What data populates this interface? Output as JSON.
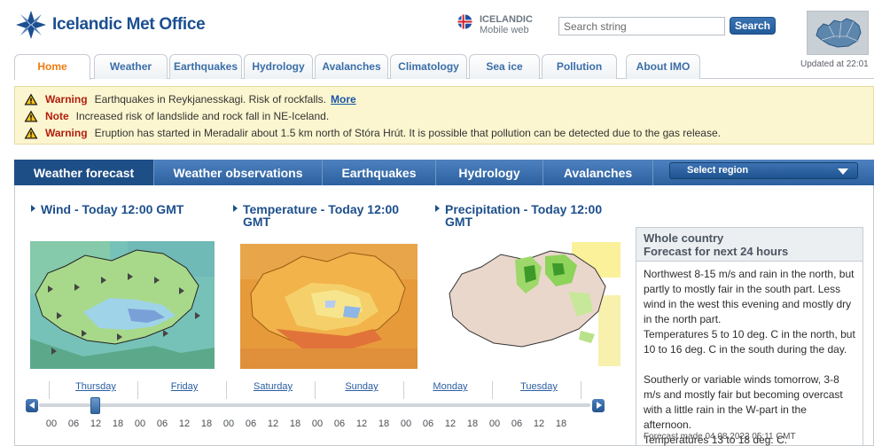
{
  "header": {
    "site_title": "Icelandic Met Office",
    "language_label": "ICELANDIC",
    "language_sub": "Mobile web",
    "search_placeholder": "Search string",
    "search_button": "Search",
    "updated": "Updated at 22:01"
  },
  "top_tabs": [
    "Home",
    "Weather",
    "Earthquakes",
    "Hydrology",
    "Avalanches",
    "Climatology",
    "Sea ice",
    "Pollution",
    "About IMO"
  ],
  "alerts": [
    {
      "kind": "Warning",
      "message": "Earthquakes in Reykjanesskagi. Risk of rockfalls.",
      "link": "More"
    },
    {
      "kind": "Note",
      "message": "Increased risk of landslide and rock fall in NE-Iceland.",
      "link": ""
    },
    {
      "kind": "Warning",
      "message": "Eruption has started in Meradalir about 1.5 km north of Stóra Hrút. It is possible that pollution can be detected due to the gas release.",
      "link": ""
    }
  ],
  "forecast_tabs": [
    "Weather forecast",
    "Weather observations",
    "Earthquakes",
    "Hydrology",
    "Avalanches"
  ],
  "region_select": "Select region",
  "maps": {
    "wind_title": "Wind - Today 12:00 GMT",
    "temp_title_line1": "Temperature - Today 12:00",
    "temp_title_line2": "GMT",
    "precip_title_line1": "Precipitation - Today 12:00",
    "precip_title_line2": "GMT"
  },
  "text_forecast": {
    "title_line1": "Whole country",
    "title_line2": "Forecast for next 24 hours",
    "p1": "Northwest 8-15 m/s and rain in the north, but partly to mostly fair in the south part. Less wind in the west this evening and mostly dry in the north part.",
    "p2": "Temperatures 5 to 10 deg. C in the north, but 10 to 16 deg. C in the south during the day.",
    "p3": "Southerly or variable winds tomorrow, 3-8 m/s and mostly fair but becoming overcast with a little rain in the W-part in the afternoon.",
    "p4": "Temperatures 13 to 18 deg. C.",
    "made": "Forecast made 04.08.2022 05:11 GMT"
  },
  "timeline": {
    "days": [
      "Thursday",
      "Friday",
      "Saturday",
      "Sunday",
      "Monday",
      "Tuesday"
    ],
    "hours": [
      "00",
      "06",
      "12",
      "18",
      "00",
      "06",
      "12",
      "18",
      "00",
      "06",
      "12",
      "18",
      "00",
      "06",
      "12",
      "18",
      "00",
      "06",
      "12",
      "18",
      "00",
      "06",
      "12",
      "18"
    ],
    "selected_hour_index": 2
  },
  "icons": [
    "imo-logo-icon",
    "iceland-flag-icon",
    "warning-icon",
    "chevron-down-icon",
    "arrow-left-icon",
    "arrow-right-icon"
  ],
  "colors": {
    "brand_blue": "#1b4f91",
    "active_tab_orange": "#f07c10",
    "alert_bg": "#fbf6cf",
    "alert_red": "#b21d0f"
  }
}
